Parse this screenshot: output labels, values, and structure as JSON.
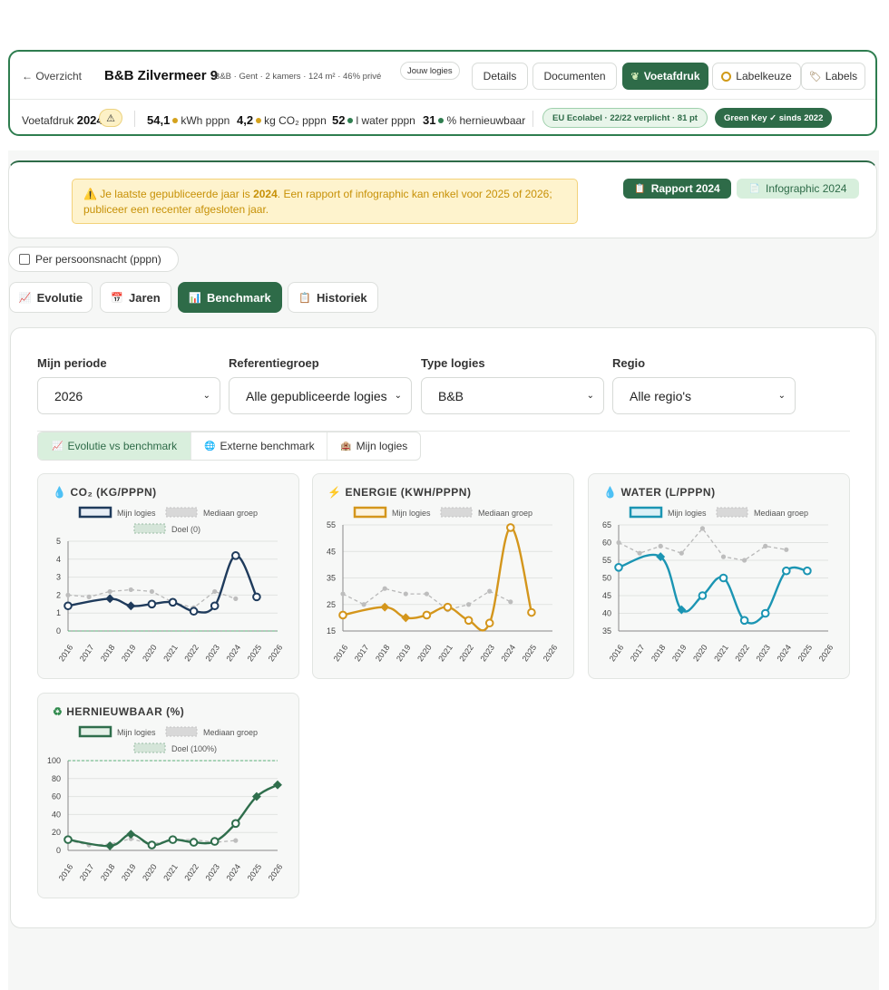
{
  "header": {
    "back_label": "← Overzicht",
    "property_name": "B&B Zilvermeer 9",
    "property_meta": "B&B · Gent · 2 kamers · 124 m² · 46% privé",
    "owner_badge": "Jouw logies",
    "tabs": [
      {
        "label": "Details",
        "icon": "",
        "active": false
      },
      {
        "label": "Documenten",
        "icon": "",
        "active": false
      },
      {
        "label": "Voetafdruk",
        "icon": "leaf-icon",
        "active": true
      },
      {
        "label": "Labelkeuze",
        "icon": "label-choice-icon",
        "active": false
      },
      {
        "label": "Labels",
        "icon": "tag-icon",
        "active": false
      }
    ],
    "footprint_label": "Voetafdruk",
    "footprint_year": "2024",
    "stats": [
      {
        "value": "54,1",
        "unit": "kWh pppn",
        "dot": "#d4a21c"
      },
      {
        "value": "4,2",
        "unit": "kg CO₂ pppn",
        "dot": "#d4a21c"
      },
      {
        "value": "52",
        "unit": "l water pppn",
        "dot": "#2e7d4f"
      },
      {
        "value": "31",
        "unit": "% hernieuwbaar",
        "dot": "#2e7d4f"
      }
    ],
    "eu_badge": "EU Ecolabel · 22/22 verplicht · 81 pt",
    "greenkey_badge": "Green Key ✓ sinds 2022"
  },
  "notice": {
    "text_before": "Je laatste gepubliceerde jaar is ",
    "year": "2024",
    "text_after": ". Een rapport of infographic kan enkel voor 2025 of 2026; publiceer een recenter afgesloten jaar.",
    "report_btn": "Rapport 2024",
    "infographic_btn": "Infographic 2024"
  },
  "toggle": {
    "label": "Per persoonsnacht (pppn)",
    "checked": false
  },
  "main_tabs": [
    {
      "label": "Evolutie",
      "icon": "chart-icon",
      "active": false
    },
    {
      "label": "Jaren",
      "icon": "calendar-icon",
      "active": false
    },
    {
      "label": "Benchmark",
      "icon": "bar-chart-icon",
      "active": true
    },
    {
      "label": "Historiek",
      "icon": "clipboard-icon",
      "active": false
    }
  ],
  "filters": [
    {
      "label": "Mijn periode",
      "value": "2026"
    },
    {
      "label": "Referentiegroep",
      "value": "Alle gepubliceerde logies"
    },
    {
      "label": "Type logies",
      "value": "B&B"
    },
    {
      "label": "Regio",
      "value": "Alle regio's"
    }
  ],
  "sub_tabs": [
    {
      "label": "Evolutie vs benchmark",
      "icon": "trend-icon",
      "active": true
    },
    {
      "label": "Externe benchmark",
      "icon": "globe-icon",
      "active": false
    },
    {
      "label": "Mijn logies",
      "icon": "building-icon",
      "active": false
    }
  ],
  "legend": {
    "mine": "Mijn logies",
    "median": "Mediaan groep"
  },
  "colors": {
    "primary": "#2e6b48",
    "accent_green": "#2e7d4f",
    "co2": "#1f3b5c",
    "energy": "#d4961c",
    "water": "#1b95b3",
    "renewable": "#2f6e4c",
    "median": "#b8b8b8"
  },
  "chart_data": [
    {
      "type": "line",
      "title": "CO₂ (KG/PPPN)",
      "icon": "droplet-cloud-icon",
      "x": [
        "2016",
        "2017",
        "2018",
        "2019",
        "2020",
        "2021",
        "2022",
        "2023",
        "2024",
        "2025",
        "2026"
      ],
      "ylim": [
        0,
        5
      ],
      "yticks": [
        0,
        1,
        2,
        3,
        4,
        5
      ],
      "series": [
        {
          "name": "Mijn logies",
          "values": [
            1.4,
            null,
            1.8,
            1.4,
            1.5,
            1.6,
            1.1,
            1.4,
            4.2,
            1.9,
            null
          ]
        },
        {
          "name": "Mediaan groep",
          "values": [
            2.0,
            1.9,
            2.2,
            2.3,
            2.2,
            1.6,
            1.3,
            2.2,
            1.8,
            null,
            null
          ]
        },
        {
          "name": "Doel (0)",
          "values": [
            0,
            0,
            0,
            0,
            0,
            0,
            0,
            0,
            0,
            0,
            0
          ]
        }
      ]
    },
    {
      "type": "line",
      "title": "ENERGIE (KWH/PPPN)",
      "icon": "lightning-icon",
      "x": [
        "2016",
        "2017",
        "2018",
        "2019",
        "2020",
        "2021",
        "2022",
        "2023",
        "2024",
        "2025",
        "2026"
      ],
      "ylim": [
        15,
        55
      ],
      "yticks": [
        15,
        25,
        35,
        45,
        55
      ],
      "series": [
        {
          "name": "Mijn logies",
          "values": [
            21,
            null,
            24,
            20,
            21,
            24,
            19,
            18,
            54,
            22,
            null
          ]
        },
        {
          "name": "Mediaan groep",
          "values": [
            29,
            25,
            31,
            29,
            29,
            23,
            25,
            30,
            26,
            null,
            null
          ]
        }
      ]
    },
    {
      "type": "line",
      "title": "WATER (L/PPPN)",
      "icon": "water-drop-icon",
      "x": [
        "2016",
        "2017",
        "2018",
        "2019",
        "2020",
        "2021",
        "2022",
        "2023",
        "2024",
        "2025",
        "2026"
      ],
      "ylim": [
        35,
        65
      ],
      "yticks": [
        35,
        40,
        45,
        50,
        55,
        60,
        65
      ],
      "series": [
        {
          "name": "Mijn logies",
          "values": [
            53,
            null,
            56,
            41,
            45,
            50,
            38,
            40,
            52,
            52,
            null
          ]
        },
        {
          "name": "Mediaan groep",
          "values": [
            60,
            57,
            59,
            57,
            64,
            56,
            55,
            59,
            58,
            null,
            null
          ]
        }
      ]
    },
    {
      "type": "line",
      "title": "HERNIEUWBAAR (%)",
      "icon": "recycle-icon",
      "x": [
        "2016",
        "2017",
        "2018",
        "2019",
        "2020",
        "2021",
        "2022",
        "2023",
        "2024",
        "2025",
        "2026"
      ],
      "ylim": [
        0,
        100
      ],
      "yticks": [
        0,
        20,
        40,
        60,
        80,
        100
      ],
      "series": [
        {
          "name": "Mijn logies",
          "values": [
            12,
            null,
            5,
            18,
            6,
            12,
            9,
            10,
            30,
            60,
            73
          ]
        },
        {
          "name": "Mediaan groep",
          "values": [
            11,
            6,
            7,
            13,
            7,
            12,
            12,
            9,
            11,
            null,
            null
          ]
        },
        {
          "name": "Doel (100%)",
          "values": [
            100,
            100,
            100,
            100,
            100,
            100,
            100,
            100,
            100,
            100,
            100
          ]
        }
      ]
    }
  ]
}
